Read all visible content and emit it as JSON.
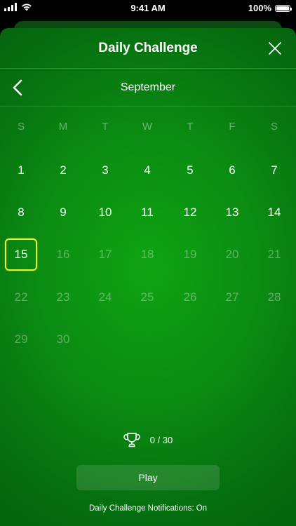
{
  "status_bar": {
    "time": "9:41 AM",
    "battery": "100%",
    "icons": [
      "signal-icon",
      "wifi-icon",
      "battery-icon"
    ]
  },
  "header": {
    "title": "Daily Challenge",
    "close_icon": "close-icon"
  },
  "calendar": {
    "back_icon": "chevron-left-icon",
    "month": "September",
    "weekdays": [
      "S",
      "M",
      "T",
      "W",
      "T",
      "F",
      "S"
    ],
    "weeks": [
      [
        "1",
        "2",
        "3",
        "4",
        "5",
        "6",
        "7"
      ],
      [
        "8",
        "9",
        "10",
        "11",
        "12",
        "13",
        "14"
      ],
      [
        "15",
        "16",
        "17",
        "18",
        "19",
        "20",
        "21"
      ],
      [
        "22",
        "23",
        "24",
        "25",
        "26",
        "27",
        "28"
      ],
      [
        "29",
        "30"
      ]
    ],
    "selected_day": "15"
  },
  "progress": {
    "icon": "trophy-icon",
    "text": "0 / 30"
  },
  "play_label": "Play",
  "notifications_text": "Daily Challenge Notifications: On",
  "colors": {
    "background_center": "#0fa312",
    "background_edge": "#05650e",
    "selected_outline": "#e8f230"
  }
}
